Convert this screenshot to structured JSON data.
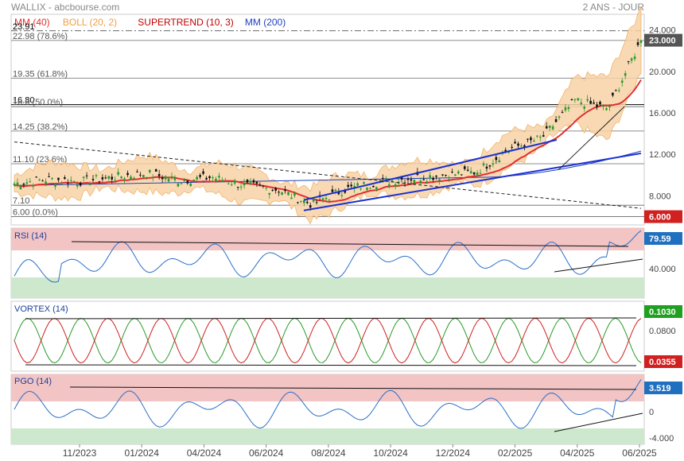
{
  "header": {
    "site": "WALLIX - abcbourse.com",
    "period": "2 ANS - JOUR"
  },
  "legend": [
    {
      "label": "MM (40)",
      "color": "#e03030"
    },
    {
      "label": "BOLL (20, 2)",
      "color": "#f0a040"
    },
    {
      "label": "SUPERTREND (10, 3)",
      "color": "#c00000"
    },
    {
      "label": "MM (200)",
      "color": "#2040c0"
    }
  ],
  "price_levels": [
    {
      "label": "23.91",
      "value": 23.91,
      "style": "dashdot"
    },
    {
      "label": "22.98  (78.6%)",
      "value": 22.98
    },
    {
      "label": "19.35  (61.8%)",
      "value": 19.35
    },
    {
      "label": "16.80",
      "value": 16.8,
      "style": "solid"
    },
    {
      "label": "16.6  (50.0%)",
      "value": 16.6
    },
    {
      "label": "14.25  (38.2%)",
      "value": 14.25
    },
    {
      "label": "11.10  (23.6%)",
      "value": 11.1
    },
    {
      "label": "7.10",
      "value": 7.1
    },
    {
      "label": "6.00  (0.0%)",
      "value": 6.0
    }
  ],
  "price_axis": {
    "ticks": [
      "24.000",
      "20.000",
      "16.000",
      "12.000",
      "8.000"
    ],
    "tick_values": [
      24,
      20,
      16,
      12,
      8
    ],
    "last_badge": "23.000",
    "last_value": 23.0,
    "low_badge": "6.000",
    "low_value": 6.0,
    "badge_last_color": "#555555",
    "badge_low_color": "#d02020"
  },
  "x_axis": {
    "labels": [
      "11/2023",
      "01/2024",
      "04/2024",
      "06/2024",
      "08/2024",
      "10/2024",
      "12/2024",
      "02/2025",
      "04/2025",
      "06/2025"
    ]
  },
  "rsi": {
    "title": "RSI (14)",
    "badge": "79.59",
    "badge_value": 79.59,
    "tick": "40.000",
    "badge_color": "#2070c0",
    "line_color": "#2a6fc8"
  },
  "vortex": {
    "title": "VORTEX (14)",
    "badge_top": "0.1030",
    "badge_bottom": "0.0355",
    "tick": "0.0800",
    "badge_top_color": "#20a020",
    "badge_bottom_color": "#d02020"
  },
  "pgo": {
    "title": "PGO (14)",
    "badge": "3.519",
    "badge_value": 3.519,
    "ticks": [
      "0",
      "-4.000"
    ],
    "badge_color": "#2070c0"
  },
  "chart_data": {
    "type": "line",
    "price_series": {
      "name": "WALLIX",
      "x": [
        "11/2023",
        "12/2023",
        "01/2024",
        "02/2024",
        "03/2024",
        "04/2024",
        "05/2024",
        "06/2024",
        "07/2024",
        "08/2024",
        "09/2024",
        "10/2024",
        "11/2024",
        "12/2024",
        "01/2025",
        "02/2025",
        "03/2025",
        "04/2025",
        "05/2025",
        "06/2025"
      ],
      "values": [
        9.2,
        9.6,
        9.4,
        9.8,
        10.2,
        9.5,
        9.8,
        9.0,
        8.6,
        7.2,
        8.6,
        9.3,
        9.7,
        10.0,
        10.3,
        12.5,
        13.6,
        17.2,
        16.4,
        23.0
      ]
    },
    "price_range": [
      5.2,
      25.5
    ],
    "rsi_range": [
      0,
      100
    ],
    "vortex_range": [
      0.02,
      0.11
    ],
    "pgo_range": [
      -5,
      5
    ]
  }
}
